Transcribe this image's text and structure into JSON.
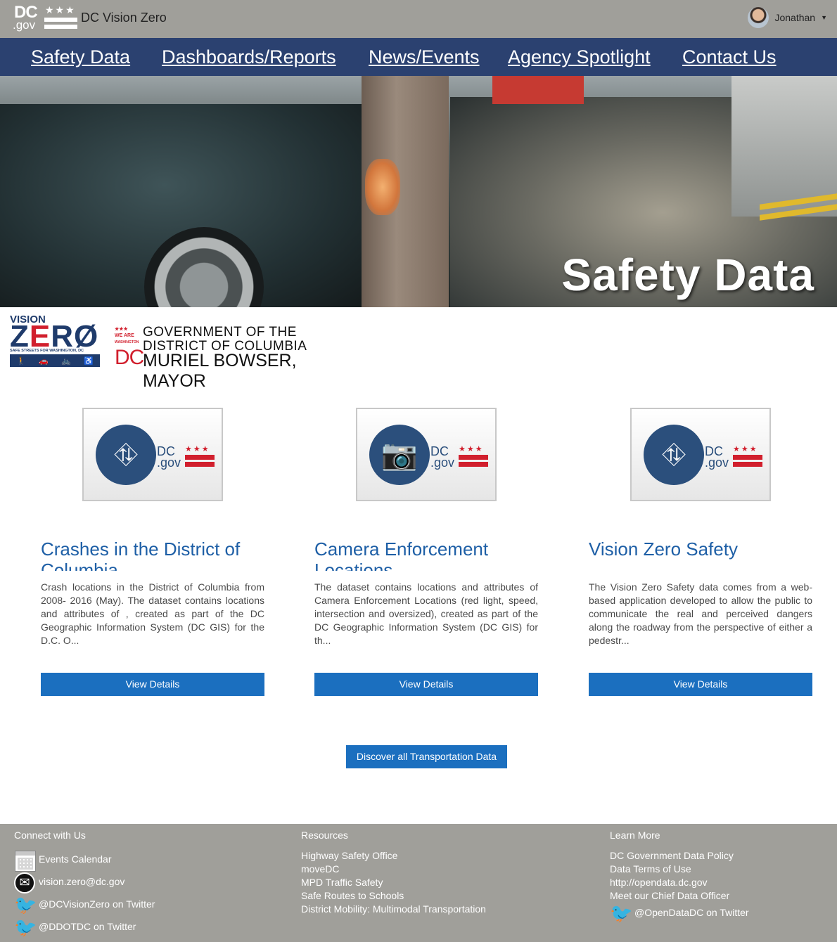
{
  "header": {
    "logo_dc": "DC",
    "logo_gov": ".gov",
    "logo_stars": "★★★",
    "site_title": "DC Vision Zero",
    "user_name": "Jonathan"
  },
  "nav": [
    {
      "label": "Safety Data"
    },
    {
      "label": "Dashboards/Reports"
    },
    {
      "label": "News/Events"
    },
    {
      "label": "Agency Spotlight"
    },
    {
      "label": "Contact Us"
    }
  ],
  "hero": {
    "title": "Safety Data"
  },
  "vision_zero_logo": {
    "vision": "VISION",
    "zero_a": "Z",
    "zero_b": "E",
    "zero_c": "RØ",
    "tagline": "SAFE STREETS FOR WASHINGTON, DC"
  },
  "gov_logo": {
    "we_are": "WE ARE",
    "washington": "WASHINGTON",
    "dc": "DC",
    "line1": "GOVERNMENT OF THE",
    "line2": "DISTRICT OF COLUMBIA",
    "line3": "MURIEL BOWSER, MAYOR"
  },
  "cards": [
    {
      "icon": "road-icon",
      "thumb_dc": "DC",
      "thumb_gov": ".gov",
      "title": "Crashes in the District of Columbia",
      "description": "Crash locations in the District of Columbia from 2008- 2016 (May). The dataset contains locations and attributes of , created as part of the DC Geographic Information System (DC GIS) for the D.C. O...",
      "button": "View Details"
    },
    {
      "icon": "camera-icon",
      "thumb_dc": "DC",
      "thumb_gov": ".gov",
      "title": "Camera Enforcement Locations",
      "description": "The dataset contains locations and attributes of Camera Enforcement Locations (red light, speed, intersection and oversized), created as part of the DC Geographic Information System (DC GIS) for th...",
      "button": "View Details"
    },
    {
      "icon": "road-icon",
      "thumb_dc": "DC",
      "thumb_gov": ".gov",
      "title": "Vision Zero Safety",
      "description": "The Vision Zero Safety data comes from a web-based application developed to allow the public to communicate the real and perceived dangers along the roadway from the perspective of either a pedestr...",
      "button": "View Details"
    }
  ],
  "discover_button": "Discover all Transportation Data",
  "footer": {
    "connect": {
      "title": "Connect with Us",
      "items": [
        {
          "icon": "calendar-icon",
          "label": "Events Calendar"
        },
        {
          "icon": "mail-icon",
          "label": "vision.zero@dc.gov"
        },
        {
          "icon": "twitter-icon",
          "label": "@DCVisionZero on Twitter"
        },
        {
          "icon": "twitter-icon",
          "label": "@DDOTDC on Twitter"
        }
      ]
    },
    "resources": {
      "title": "Resources",
      "items": [
        "Highway Safety Office",
        "moveDC",
        "MPD Traffic Safety",
        "Safe Routes to Schools",
        "District Mobility: Multimodal Transportation"
      ]
    },
    "learn": {
      "title": "Learn More",
      "items": [
        "DC Government Data Policy",
        "Data Terms of Use",
        "http://opendata.dc.gov",
        "Meet our Chief Data Officer"
      ],
      "twitter": "@OpenDataDC on Twitter"
    }
  },
  "colors": {
    "header_bg": "#a09f9a",
    "nav_bg": "#2b4170",
    "title_blue": "#1e5fa6",
    "button_blue": "#1b6fbf",
    "dc_red": "#d11f2d"
  }
}
